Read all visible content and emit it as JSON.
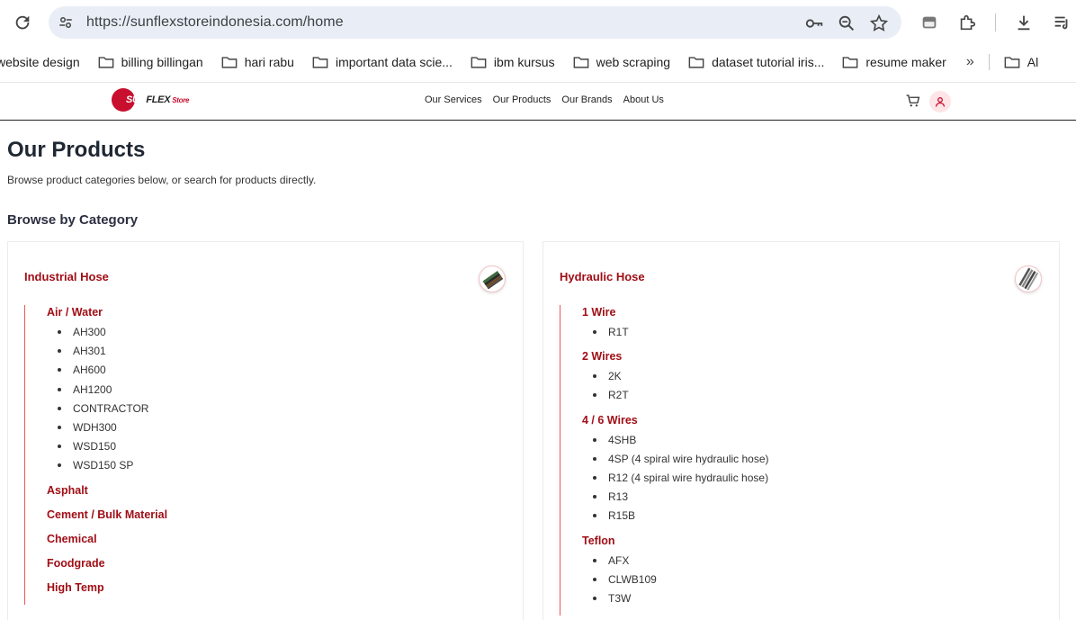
{
  "browser": {
    "url": "https://sunflexstoreindonesia.com/home",
    "bookmarks": [
      {
        "label": "website design"
      },
      {
        "label": "billing billingan"
      },
      {
        "label": "hari rabu"
      },
      {
        "label": "important data scie..."
      },
      {
        "label": "ibm kursus"
      },
      {
        "label": "web scraping"
      },
      {
        "label": "dataset tutorial iris..."
      },
      {
        "label": "resume maker"
      }
    ],
    "bookmark_overflow_icon": "chevron-double-right-icon",
    "bookmark_last_label": "Al"
  },
  "site": {
    "logo": {
      "word1": "SUN",
      "word2": "FLEX",
      "word3": "Store"
    },
    "nav": [
      "Our Services",
      "Our Products",
      "Our Brands",
      "About Us"
    ],
    "brand_color": "#a00e16"
  },
  "page": {
    "title": "Our Products",
    "subtitle": "Browse product categories below, or search for products directly.",
    "section_title": "Browse by Category"
  },
  "categories": [
    {
      "title": "Industrial Hose",
      "groups": [
        {
          "name": "Air / Water",
          "items": [
            "AH300",
            "AH301",
            "AH600",
            "AH1200",
            "CONTRACTOR",
            "WDH300",
            "WSD150",
            "WSD150 SP"
          ]
        },
        {
          "name": "Asphalt",
          "items": []
        },
        {
          "name": "Cement / Bulk Material",
          "items": []
        },
        {
          "name": "Chemical",
          "items": []
        },
        {
          "name": "Foodgrade",
          "items": []
        },
        {
          "name": "High Temp",
          "items": []
        }
      ]
    },
    {
      "title": "Hydraulic Hose",
      "groups": [
        {
          "name": "1 Wire",
          "items": [
            "R1T"
          ]
        },
        {
          "name": "2 Wires",
          "items": [
            "2K",
            "R2T"
          ]
        },
        {
          "name": "4 / 6 Wires",
          "items": [
            "4SHB",
            "4SP (4 spiral wire hydraulic hose)",
            "R12 (4 spiral wire hydraulic hose)",
            "R13",
            "R15B"
          ]
        },
        {
          "name": "Teflon",
          "items": [
            "AFX",
            "CLWB109",
            "T3W"
          ]
        }
      ]
    }
  ]
}
